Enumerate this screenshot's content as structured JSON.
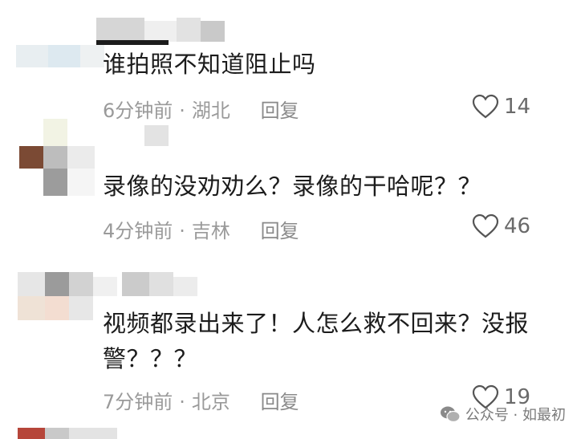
{
  "comments": [
    {
      "text": "谁拍照不知道阻止吗",
      "time": "6分钟前",
      "location": "湖北",
      "reply_label": "回复",
      "likes": "14"
    },
    {
      "text": "录像的没劝劝么？录像的干哈呢？？",
      "time": "4分钟前",
      "location": "吉林",
      "reply_label": "回复",
      "likes": "46"
    },
    {
      "text": "视频都录出来了！人怎么救不回来？没报警？？？",
      "time": "7分钟前",
      "location": "北京",
      "reply_label": "回复",
      "likes": "19"
    }
  ],
  "meta_separator": "·",
  "watermark": {
    "text": "公众号 · 如最初",
    "icon": "wechat-icon"
  },
  "icons": {
    "like": "heart-outline-icon"
  }
}
